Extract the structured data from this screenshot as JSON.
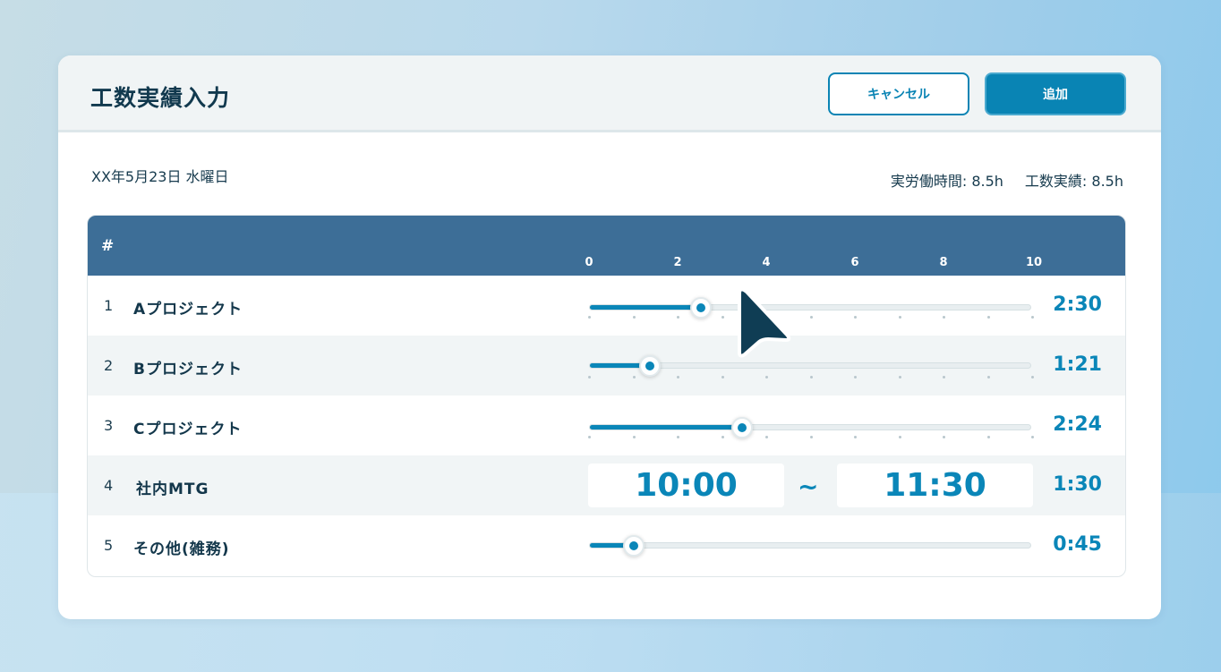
{
  "header": {
    "title": "工数実績入力",
    "cancel_label": "キャンセル",
    "add_label": "追加"
  },
  "date": "XX年5月23日 水曜日",
  "summary": {
    "actual_work": "実労働時間: 8.5h",
    "man_hours": "工数実績: 8.5h"
  },
  "table": {
    "hash_header": "#",
    "scale": [
      "0",
      "2",
      "4",
      "6",
      "8",
      "10"
    ],
    "scale_max_hours": 10,
    "rows": [
      {
        "num": "1",
        "name": "Aプロジェクト",
        "time": "2:30",
        "type": "slider",
        "hours": 2.5
      },
      {
        "num": "2",
        "name": "Bプロジェクト",
        "time": "1:21",
        "type": "slider",
        "hours": 1.35
      },
      {
        "num": "3",
        "name": "Cプロジェクト",
        "time": "2:24",
        "type": "slider",
        "hours": 3.45
      },
      {
        "num": "4",
        "name": "社内MTG",
        "time": "1:30",
        "type": "range",
        "start": "10:00",
        "tilde": "~",
        "end": "11:30"
      },
      {
        "num": "5",
        "name": "その他(雑務)",
        "time": "0:45",
        "type": "slider",
        "hours": 1.0
      }
    ]
  },
  "colors": {
    "accent": "#0a86b8",
    "header_bar": "#3d6e97",
    "title_text": "#11394e"
  },
  "icons": {
    "cursor": "mouse-pointer-icon"
  }
}
